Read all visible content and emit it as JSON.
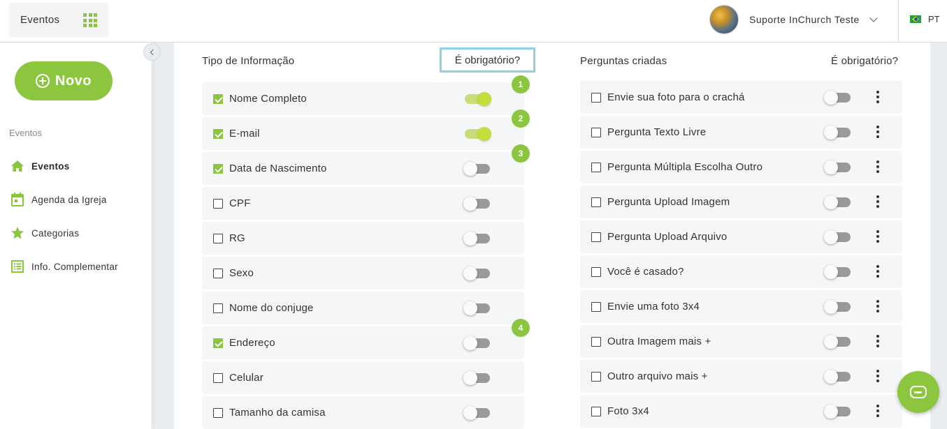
{
  "header": {
    "app_name": "Eventos",
    "user_name": "Suporte InChurch Teste",
    "language": "PT"
  },
  "sidebar": {
    "new_button_label": "Novo",
    "section_title": "Eventos",
    "items": [
      {
        "label": "Eventos",
        "icon": "home-icon",
        "active": true
      },
      {
        "label": "Agenda da Igreja",
        "icon": "calendar-icon",
        "active": false
      },
      {
        "label": "Categorias",
        "icon": "star-icon",
        "active": false
      },
      {
        "label": "Info. Complementar",
        "icon": "list-icon",
        "active": false
      }
    ]
  },
  "info_types": {
    "header_label": "Tipo de Informação",
    "required_label": "É obrigatório?",
    "rows": [
      {
        "label": "Nome Completo",
        "checked": true,
        "required": true
      },
      {
        "label": "E-mail",
        "checked": true,
        "required": true
      },
      {
        "label": "Data de Nascimento",
        "checked": true,
        "required": false
      },
      {
        "label": "CPF",
        "checked": false,
        "required": false
      },
      {
        "label": "RG",
        "checked": false,
        "required": false
      },
      {
        "label": "Sexo",
        "checked": false,
        "required": false
      },
      {
        "label": "Nome do conjuge",
        "checked": false,
        "required": false
      },
      {
        "label": "Endereço",
        "checked": true,
        "required": false
      },
      {
        "label": "Celular",
        "checked": false,
        "required": false
      },
      {
        "label": "Tamanho da camisa",
        "checked": false,
        "required": false
      }
    ]
  },
  "created_questions": {
    "header_label": "Perguntas criadas",
    "required_label": "É obrigatório?",
    "rows": [
      {
        "label": "Envie sua foto para o crachá",
        "checked": false,
        "required": false
      },
      {
        "label": "Pergunta Texto Livre",
        "checked": false,
        "required": false
      },
      {
        "label": "Pergunta Múltipla Escolha Outro",
        "checked": false,
        "required": false
      },
      {
        "label": "Pergunta Upload Imagem",
        "checked": false,
        "required": false
      },
      {
        "label": "Pergunta Upload Arquivo",
        "checked": false,
        "required": false
      },
      {
        "label": "Você é casado?",
        "checked": false,
        "required": false
      },
      {
        "label": "Envie uma foto 3x4",
        "checked": false,
        "required": false
      },
      {
        "label": "Outra Imagem mais +",
        "checked": false,
        "required": false
      },
      {
        "label": "Outro arquivo mais +",
        "checked": false,
        "required": false
      },
      {
        "label": "Foto 3x4",
        "checked": false,
        "required": false
      }
    ]
  },
  "step_markers": [
    "1",
    "2",
    "3",
    "4"
  ],
  "colors": {
    "accent": "#8cc63f",
    "highlight_border": "#8fd0e6",
    "toggle_on": "#c4dc3c"
  }
}
